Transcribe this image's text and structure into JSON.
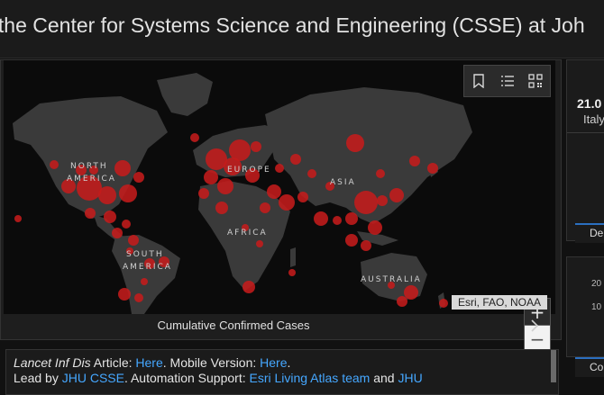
{
  "header": {
    "title": "y the Center for Systems Science and Engineering (CSSE) at Joh"
  },
  "map": {
    "continent_labels": [
      "NORTH",
      "AMERICA",
      "EUROPE",
      "ASIA",
      "AFRICA",
      "SOUTH",
      "AMERICA",
      "AUSTRALIA"
    ],
    "tools": [
      "bookmark-icon",
      "legend-list-icon",
      "qr-code-icon"
    ],
    "zoom_in": "+",
    "zoom_out": "−",
    "attribution": "Esri, FAO, NOAA",
    "caption": "Cumulative Confirmed Cases",
    "colors": {
      "bubble": "#c41b1b",
      "land": "#3a3a3a",
      "ocean": "#0b0b0b"
    }
  },
  "info": {
    "line1": {
      "journal": "Lancet Inf Dis",
      "article_label": " Article: ",
      "here1": "Here",
      "mobile_label": ". Mobile Version: ",
      "here2": "Here",
      "end": "."
    },
    "line2": {
      "lead_label": "Lead by ",
      "jhu_csse": "JHU CSSE",
      "automation_label": ". Automation Support: ",
      "esri_team": "Esri Living Atlas team",
      "and_label": " and ",
      "jhu": "JHU"
    }
  },
  "right": {
    "card_number": "21.0",
    "card_country": "Italy",
    "tab1": "De",
    "axis_a": "20",
    "axis_b": "10",
    "tab2": "Co"
  }
}
